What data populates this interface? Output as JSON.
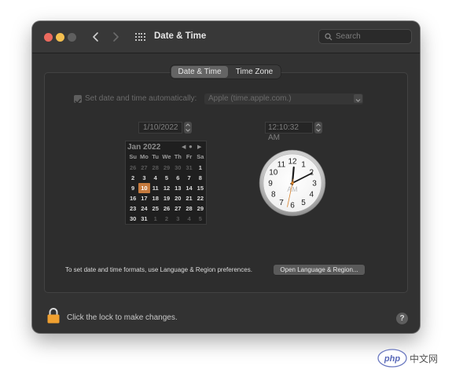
{
  "window": {
    "title": "Date & Time",
    "search_placeholder": "Search",
    "traffic_lights": [
      "#ec6a5e",
      "#f4bf4f",
      "#61c554"
    ]
  },
  "tabs": [
    {
      "label": "Date & Time",
      "selected": true
    },
    {
      "label": "Time Zone",
      "selected": false
    }
  ],
  "auto": {
    "label": "Set date and time automatically:",
    "checked": true,
    "server": "Apple (time.apple.com.)"
  },
  "date_field": "1/10/2022",
  "time_field": "12:10:32 AM",
  "calendar": {
    "month_label": "Jan 2022",
    "weekdays": [
      "Su",
      "Mo",
      "Tu",
      "We",
      "Th",
      "Fr",
      "Sa"
    ],
    "days": [
      {
        "d": "26",
        "dim": true
      },
      {
        "d": "27",
        "dim": true
      },
      {
        "d": "28",
        "dim": true
      },
      {
        "d": "29",
        "dim": true
      },
      {
        "d": "30",
        "dim": true
      },
      {
        "d": "31",
        "dim": true
      },
      {
        "d": "1"
      },
      {
        "d": "2"
      },
      {
        "d": "3"
      },
      {
        "d": "4"
      },
      {
        "d": "5"
      },
      {
        "d": "6"
      },
      {
        "d": "7"
      },
      {
        "d": "8"
      },
      {
        "d": "9"
      },
      {
        "d": "10",
        "selected": true
      },
      {
        "d": "11"
      },
      {
        "d": "12"
      },
      {
        "d": "13"
      },
      {
        "d": "14"
      },
      {
        "d": "15"
      },
      {
        "d": "16"
      },
      {
        "d": "17"
      },
      {
        "d": "18"
      },
      {
        "d": "19"
      },
      {
        "d": "20"
      },
      {
        "d": "21"
      },
      {
        "d": "22"
      },
      {
        "d": "23"
      },
      {
        "d": "24"
      },
      {
        "d": "25"
      },
      {
        "d": "26"
      },
      {
        "d": "27"
      },
      {
        "d": "28"
      },
      {
        "d": "29"
      },
      {
        "d": "30"
      },
      {
        "d": "31"
      },
      {
        "d": "1",
        "dim": true
      },
      {
        "d": "2",
        "dim": true
      },
      {
        "d": "3",
        "dim": true
      },
      {
        "d": "4",
        "dim": true
      },
      {
        "d": "5",
        "dim": true
      }
    ],
    "selected_color": "#c67a3d"
  },
  "clock": {
    "numbers": [
      "12",
      "1",
      "2",
      "3",
      "4",
      "5",
      "6",
      "7",
      "8",
      "9",
      "10",
      "11"
    ],
    "am_pm": "AM",
    "hour": 12,
    "minute": 10,
    "second": 32
  },
  "formats_text": "To set date and time formats, use Language & Region preferences.",
  "open_button": "Open Language & Region...",
  "lock_text": "Click the lock to make changes.",
  "help": "?",
  "watermark": "中文网",
  "accent_lock": "#f0a030"
}
